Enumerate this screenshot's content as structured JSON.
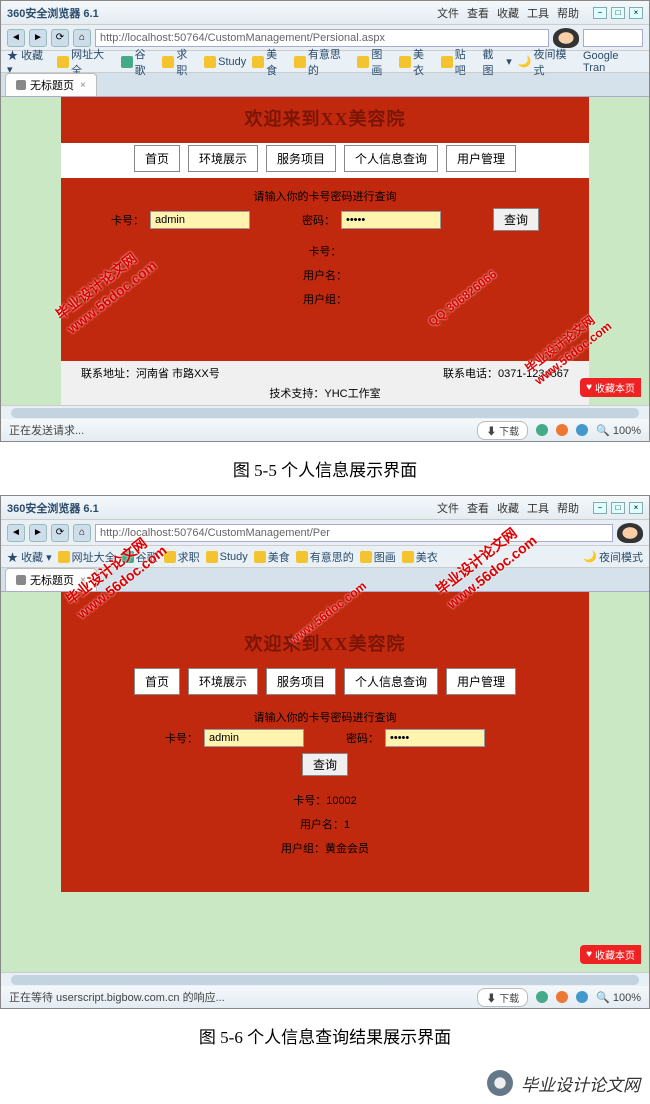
{
  "browser": {
    "title": "360安全浏览器 6.1",
    "menus": [
      "文件",
      "查看",
      "收藏",
      "工具",
      "帮助"
    ],
    "address": "http://localhost:50764/CustomManagement/Persional.aspx",
    "tab_label": "无标题页"
  },
  "bookmarks": {
    "fav_label": "收藏",
    "items": [
      "网址大全",
      "谷歌",
      "求职",
      "Study",
      "美食",
      "有意思的",
      "图画",
      "美衣",
      "贴吧"
    ],
    "right_items": [
      "截图",
      "夜间模式",
      "Google Tran"
    ]
  },
  "page": {
    "welcome": "欢迎来到XX美容院",
    "nav": [
      "首页",
      "环境展示",
      "服务项目",
      "个人信息查询",
      "用户管理"
    ],
    "prompt": "请输入你的卡号密码进行查询",
    "card_label": "卡号：",
    "card_value": "admin",
    "pwd_label": "密码：",
    "pwd_value": "•••••",
    "query_btn": "查询",
    "r_card": "卡号：",
    "r_user": "用户名：",
    "r_group": "用户组："
  },
  "page2": {
    "r_card": "卡号：10002",
    "r_user": "用户名：1",
    "r_group": "用户组：黄金会员"
  },
  "footer": {
    "addr": "联系地址：河南省       市路XX号",
    "tel": "联系电话：0371-1234567",
    "support": "技术支持：YHC工作室"
  },
  "fav_btn": "收藏本页",
  "status": {
    "s1": "正在发送请求...",
    "s2": "正在等待 userscript.bigbow.com.cn 的响应...",
    "download": "下载",
    "zoom": "100%"
  },
  "captions": {
    "c1": "图 5-5 个人信息展示界面",
    "c2": "图 5-6 个人信息查询结果展示界面"
  },
  "watermark": {
    "url": "www.56doc.com",
    "qq": "QQ:306826066",
    "brand": "毕业设计论文网"
  },
  "address2": "http://localhost:50764/CustomManagement/Per"
}
